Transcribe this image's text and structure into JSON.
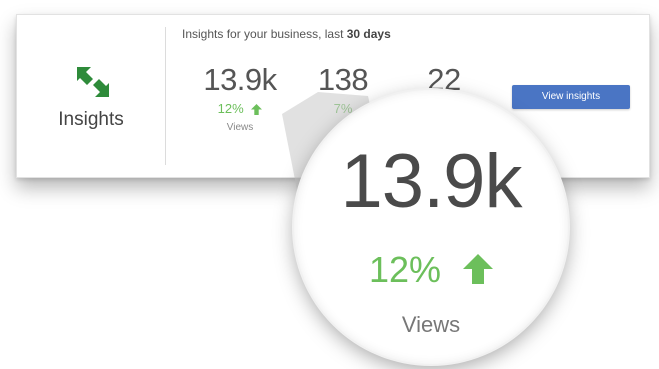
{
  "card": {
    "title": "Insights",
    "subtitle_prefix": "Insights for your business, last ",
    "subtitle_bold": "30 days",
    "button_label": "View insights",
    "metrics": [
      {
        "value": "13.9k",
        "change": "12%",
        "direction": "up",
        "label": "Views"
      },
      {
        "value": "138",
        "change": "7%",
        "direction": "up",
        "label": ""
      },
      {
        "value": "22",
        "change": "",
        "direction": "",
        "label": ""
      }
    ]
  },
  "magnified": {
    "value": "13.9k",
    "change": "12%",
    "direction": "up",
    "label": "Views"
  },
  "colors": {
    "accent_green": "#6cbf5b",
    "icon_green": "#2e8b3a",
    "button_blue": "#4a75c4"
  },
  "icons": {
    "logo": "insights-arrows-icon",
    "trend": "arrow-up-icon"
  }
}
